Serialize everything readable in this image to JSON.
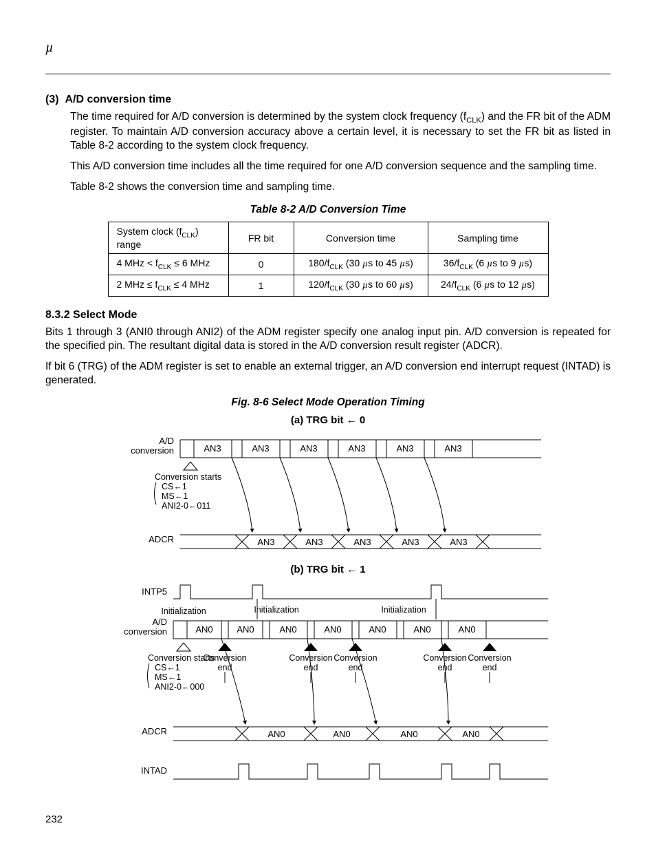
{
  "header": {
    "mu": "µ"
  },
  "section3": {
    "num": "(3)",
    "title": "A/D conversion time",
    "p1a": "The time required for A/D conversion is determined by the system clock frequency (f",
    "p1b": ") and the FR bit of the ADM register.  To maintain A/D conversion accuracy above a certain level, it is necessary to set the FR bit as listed in Table 8-2 according to the system clock frequency.",
    "p2": "This A/D conversion time includes all the time required for one A/D conversion sequence and the sampling time.",
    "p3": "Table 8-2 shows the conversion time and sampling time."
  },
  "table82": {
    "caption": "Table 8-2  A/D Conversion Time",
    "h1a": "System clock (f",
    "h1b": ") range",
    "h2": "FR bit",
    "h3": "Conversion time",
    "h4": "Sampling time",
    "r1c1a": "4 MHz < f",
    "r1c1b": " ≤ 6 MHz",
    "r1c2": "0",
    "r1c3a": "180/f",
    "r1c3b": " (30 ",
    "r1c3c": "s to 45 ",
    "r1c3d": "s)",
    "r1c4a": "36/f",
    "r1c4b": " (6 ",
    "r1c4c": "s to 9 ",
    "r1c4d": "s)",
    "r2c1a": "2 MHz ≤ f",
    "r2c1b": " ≤ 4 MHz",
    "r2c2": "1",
    "r2c3a": "120/f",
    "r2c3b": " (30 ",
    "r2c3c": "s to 60 ",
    "r2c3d": "s)",
    "r2c4a": "24/f",
    "r2c4b": " (6 ",
    "r2c4c": "s to 12 ",
    "r2c4d": "s)",
    "clk": "CLK",
    "mu": "µ"
  },
  "section832": {
    "heading": "8.3.2  Select Mode",
    "p1": "Bits 1 through 3 (ANI0 through ANI2) of the ADM register specify one analog input pin.  A/D conversion is repeated for the specified pin.  The resultant digital data is stored in the A/D conversion result register (ADCR).",
    "p2": "If bit 6 (TRG) of the ADM register is set to enable an external trigger, an A/D conversion end interrupt request (INTAD) is generated."
  },
  "fig86": {
    "caption": "Fig. 8-6  Select Mode Operation Timing",
    "sub_a": "(a)  TRG bit ← 0",
    "sub_b": "(b)  TRG bit ← 1"
  },
  "diagA": {
    "ad_label1": "A/D",
    "ad_label2": "conversion",
    "conv_starts": "Conversion starts",
    "cs": "CS←1",
    "ms": "MS←1",
    "ani": "ANI2-0←011",
    "adcr": "ADCR",
    "an3": "AN3"
  },
  "diagB": {
    "intp5": "INTP5",
    "init": "Initialization",
    "ad_label1": "A/D",
    "ad_label2": "conversion",
    "conv_starts": "Conversion starts",
    "cs": "CS←1",
    "ms": "MS←1",
    "ani": "ANI2-0←000",
    "adcr": "ADCR",
    "intad": "INTAD",
    "an0": "AN0",
    "conv_end1": "Conversion",
    "conv_end2": "end"
  },
  "page_number": "232"
}
